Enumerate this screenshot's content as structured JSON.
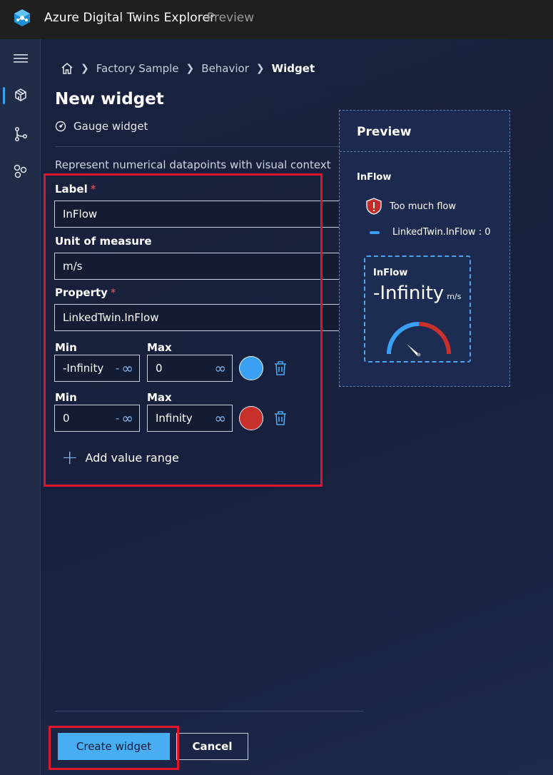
{
  "app": {
    "title": "Azure Digital Twins Explorer",
    "badge": "Preview"
  },
  "nav": {
    "icons": [
      "menu-icon",
      "scene-builder-icon",
      "graph-icon",
      "model-icon"
    ]
  },
  "breadcrumb": {
    "items": [
      "Factory Sample",
      "Behavior"
    ],
    "current": "Widget"
  },
  "page": {
    "title": "New widget",
    "widget_type": "Gauge widget",
    "description": "Represent numerical datapoints with visual context"
  },
  "form": {
    "label": {
      "label": "Label",
      "required_mark": "*",
      "value": "InFlow"
    },
    "unit": {
      "label": "Unit of measure",
      "value": "m/s"
    },
    "property": {
      "label": "Property",
      "required_mark": "*",
      "value": "LinkedTwin.InFlow"
    },
    "ranges": [
      {
        "min_label": "Min",
        "max_label": "Max",
        "min": "-Infinity",
        "min_toggle": "-",
        "max": "0",
        "max_toggle": "",
        "color": "#3aa0f3"
      },
      {
        "min_label": "Min",
        "max_label": "Max",
        "min": "0",
        "min_toggle": "-",
        "max": "Infinity",
        "max_toggle": "",
        "color": "#c8302c"
      }
    ],
    "add_range": "Add value range"
  },
  "preview": {
    "heading": "Preview",
    "name": "InFlow",
    "alert": "Too much flow",
    "status": "LinkedTwin.InFlow : 0",
    "gauge": {
      "label": "InFlow",
      "value": "-Infinity",
      "unit": "m/s"
    }
  },
  "footer": {
    "create": "Create widget",
    "cancel": "Cancel"
  },
  "colors": {
    "accent": "#48aef4",
    "highlight": "#e0142a"
  }
}
